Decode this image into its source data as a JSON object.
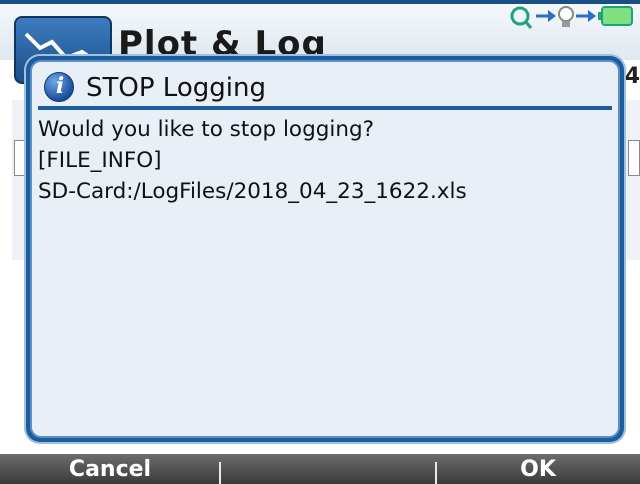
{
  "app": {
    "title": "Plot & Log",
    "right_char": "4"
  },
  "dialog": {
    "title": "STOP Logging",
    "lines": [
      "Would you like to stop logging?",
      "[FILE_INFO]",
      "SD-Card:/LogFiles/2018_04_23_1622.xls"
    ],
    "icon": "info-icon"
  },
  "softkeys": {
    "left": "Cancel",
    "middle": "",
    "right": "OK"
  },
  "colors": {
    "accent": "#1e5d9c",
    "dialog_bg": "#e9eff7",
    "softkey_bar": "#4a4a4a"
  }
}
